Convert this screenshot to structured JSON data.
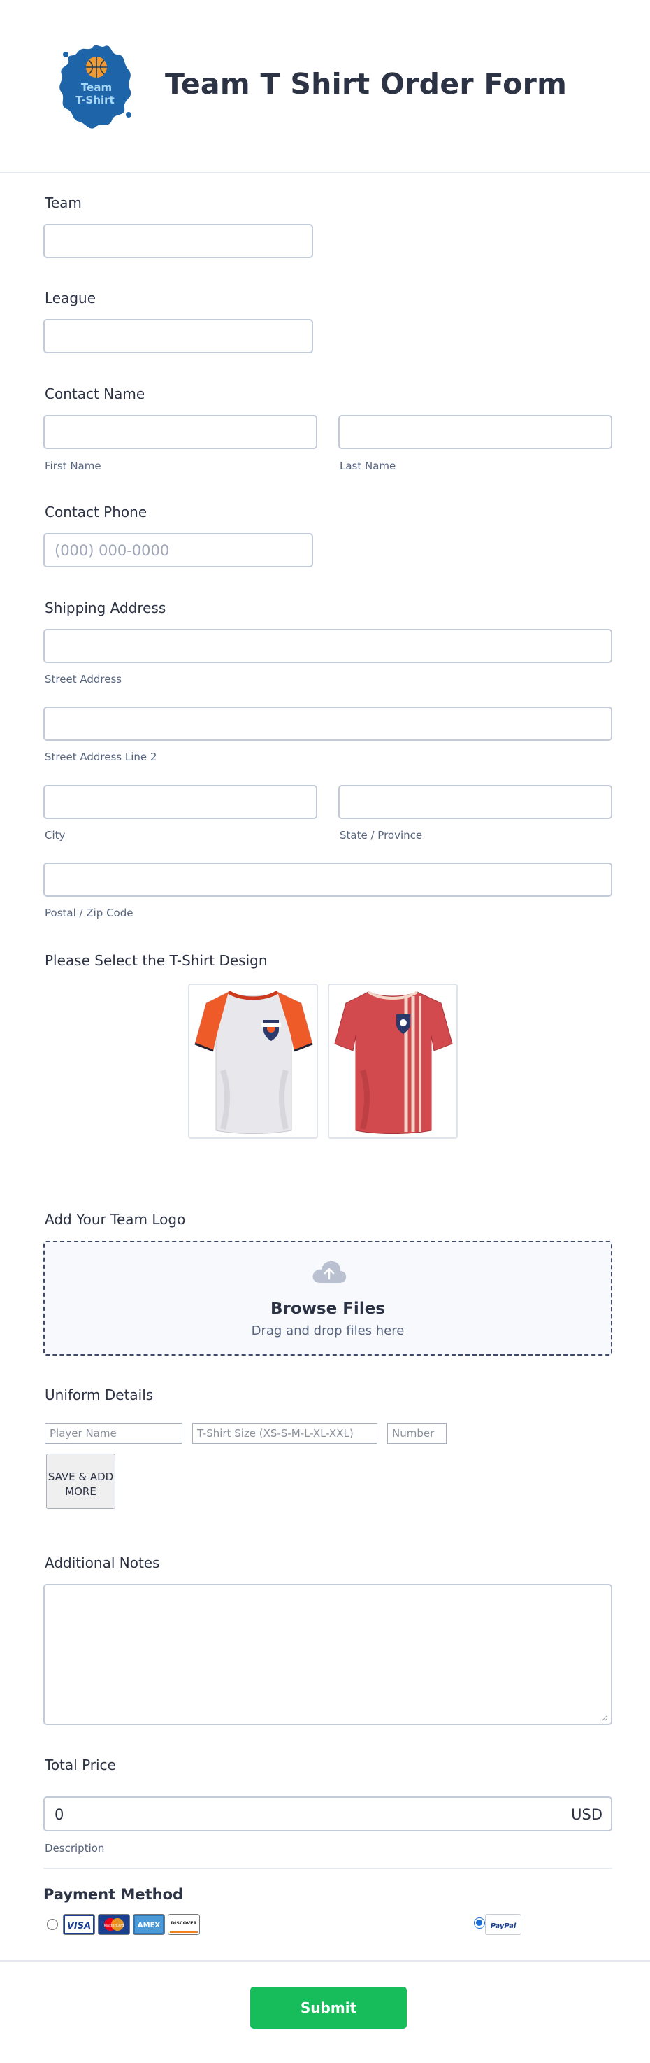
{
  "header": {
    "title": "Team T Shirt Order Form",
    "logo_text": "Team T-Shirt"
  },
  "fields": {
    "team": {
      "label": "Team",
      "value": ""
    },
    "league": {
      "label": "League",
      "value": ""
    },
    "contact_name": {
      "label": "Contact Name",
      "first_sublabel": "First Name",
      "last_sublabel": "Last Name"
    },
    "contact_phone": {
      "label": "Contact Phone",
      "placeholder": "(000) 000-0000"
    },
    "shipping": {
      "label": "Shipping Address",
      "street_sublabel": "Street Address",
      "street2_sublabel": "Street Address Line 2",
      "city_sublabel": "City",
      "state_sublabel": "State / Province",
      "postal_sublabel": "Postal / Zip Code"
    },
    "design": {
      "label": "Please Select the T-Shirt Design",
      "options": [
        "white-orange-shirt",
        "red-striped-shirt"
      ]
    },
    "logo_upload": {
      "label": "Add Your Team Logo",
      "browse_text": "Browse Files",
      "drag_text": "Drag and drop files here"
    },
    "uniform": {
      "label": "Uniform Details",
      "player_placeholder": "Player Name",
      "size_placeholder": "T-Shirt Size (XS-S-M-L-XL-XXL)",
      "number_placeholder": "Number",
      "save_button": "SAVE & ADD MORE"
    },
    "notes": {
      "label": "Additional Notes"
    },
    "total_price": {
      "label": "Total Price",
      "value": "0",
      "currency": "USD",
      "sublabel": "Description"
    },
    "payment": {
      "label": "Payment Method",
      "cards": [
        "VISA",
        "MasterCard",
        "AMEX",
        "DISCOVER"
      ],
      "paypal": "PayPal",
      "selected": "paypal"
    }
  },
  "submit_label": "Submit",
  "colors": {
    "submit": "#18bd5b",
    "text": "#2c3345",
    "border": "#c3cad8"
  }
}
